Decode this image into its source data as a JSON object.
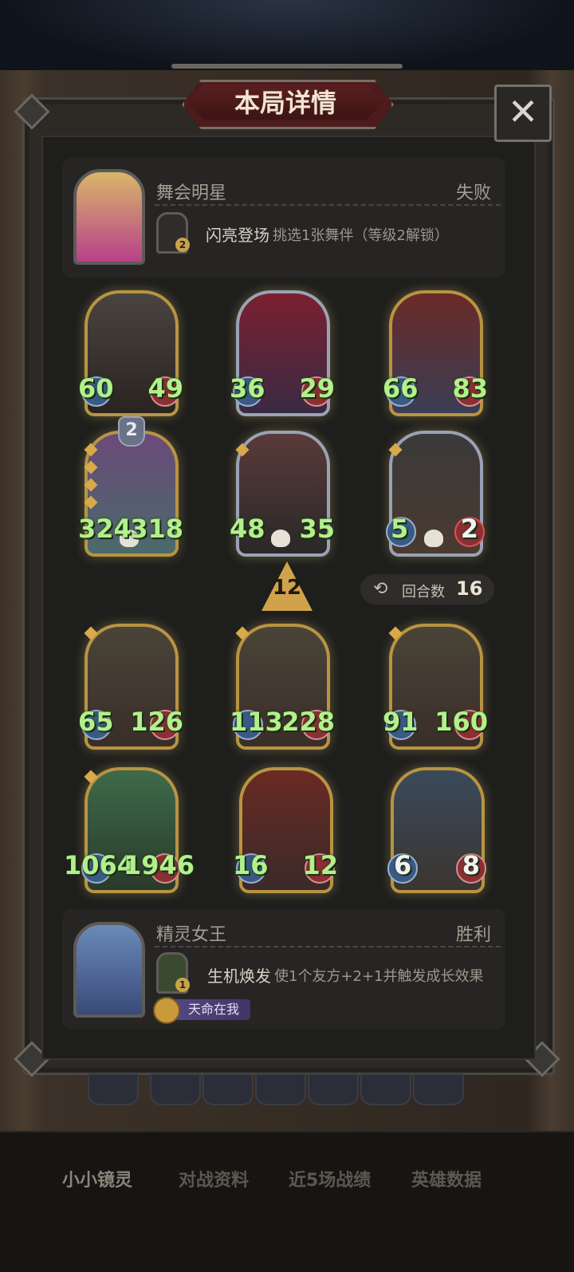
{
  "window": {
    "title": "本局详情"
  },
  "opponent": {
    "name": "舞会明星",
    "result": "失败",
    "skill": {
      "level": "2",
      "name": "闪亮登场",
      "desc": "挑选1张舞伴（等级2解锁）"
    }
  },
  "board_top": [
    {
      "atk": "60",
      "hp": "49",
      "frame": "gold"
    },
    {
      "atk": "36",
      "hp": "29",
      "frame": "silver"
    },
    {
      "atk": "66",
      "hp": "83",
      "frame": "gold"
    },
    {
      "atk": "324",
      "hp": "318",
      "frame": "gold",
      "gem": "2"
    },
    {
      "atk": "48",
      "hp": "35",
      "frame": "silver"
    },
    {
      "atk": "5",
      "hp": "2",
      "frame": "silver"
    }
  ],
  "level_badge": "12",
  "turns": {
    "label": "回合数",
    "value": "16"
  },
  "board_bottom": [
    {
      "atk": "65",
      "hp": "126",
      "frame": "gold"
    },
    {
      "atk": "113",
      "hp": "228",
      "frame": "gold"
    },
    {
      "atk": "91",
      "hp": "160",
      "frame": "gold"
    },
    {
      "atk": "1064",
      "hp": "1946",
      "frame": "gold"
    },
    {
      "atk": "16",
      "hp": "12",
      "frame": "gold"
    },
    {
      "atk": "6",
      "hp": "8",
      "frame": "gold"
    }
  ],
  "player": {
    "name": "精灵女王",
    "result": "胜利",
    "skill": {
      "level": "1",
      "name": "生机焕发",
      "desc": "使1个友方+2+1并触发成长效果"
    },
    "badge": "天命在我"
  },
  "bottom_tabs": [
    "小小镜灵",
    "对战资料",
    "近5场战绩",
    "英雄数据"
  ],
  "icons": {
    "close": "close-icon",
    "turns": "refresh-icon"
  }
}
